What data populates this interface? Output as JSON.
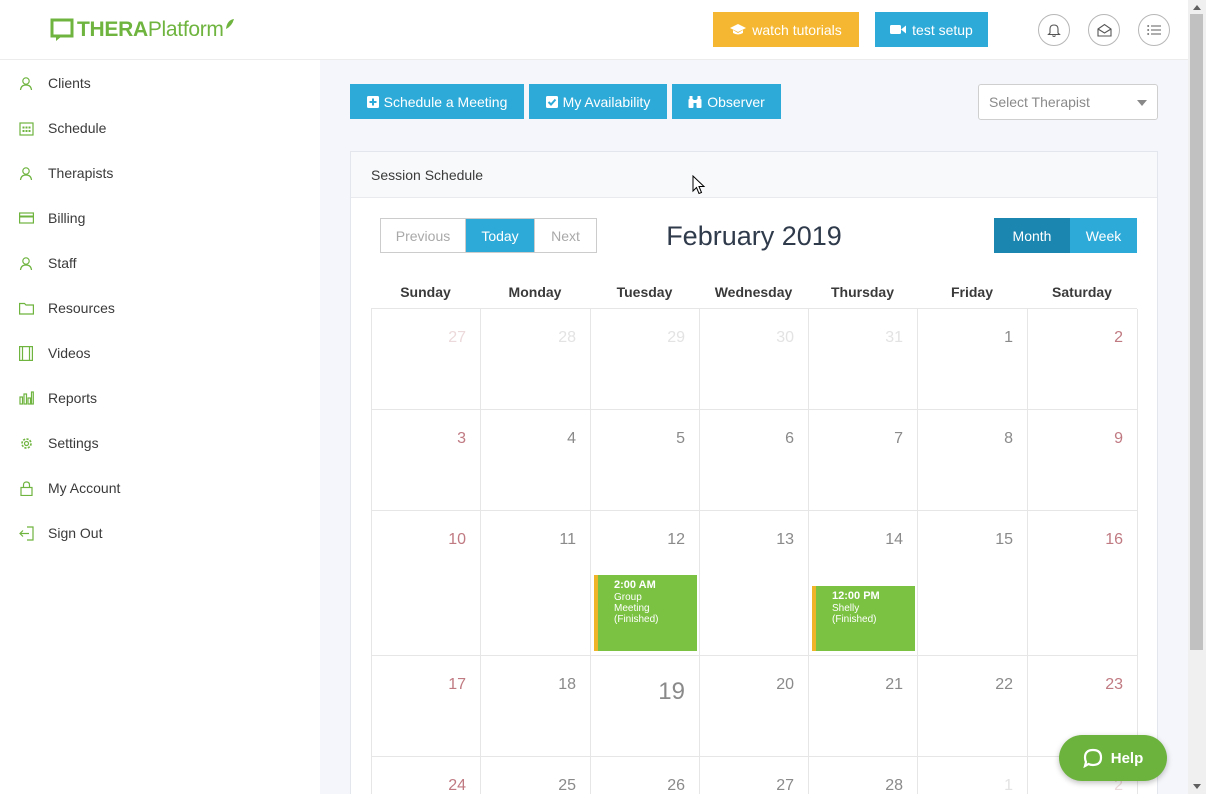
{
  "app": {
    "logo_bold": "THERA",
    "logo_light": "Platform",
    "brand_color": "#6eb43f"
  },
  "header": {
    "tutorials_label": "watch tutorials",
    "test_setup_label": "test setup",
    "icons": [
      "bell-icon",
      "mail-icon",
      "menu-list-icon"
    ]
  },
  "sidebar": {
    "items": [
      {
        "label": "Clients",
        "icon": "user-icon"
      },
      {
        "label": "Schedule",
        "icon": "calendar-icon"
      },
      {
        "label": "Therapists",
        "icon": "user-icon"
      },
      {
        "label": "Billing",
        "icon": "card-icon"
      },
      {
        "label": "Staff",
        "icon": "user-icon"
      },
      {
        "label": "Resources",
        "icon": "folder-icon"
      },
      {
        "label": "Videos",
        "icon": "film-icon"
      },
      {
        "label": "Reports",
        "icon": "bar-chart-icon"
      },
      {
        "label": "Settings",
        "icon": "gear-icon"
      },
      {
        "label": "My Account",
        "icon": "lock-icon"
      },
      {
        "label": "Sign Out",
        "icon": "sign-out-icon"
      }
    ]
  },
  "actions": {
    "schedule_meeting": "Schedule a Meeting",
    "my_availability": "My Availability",
    "observer": "Observer",
    "therapist_placeholder": "Select Therapist"
  },
  "calendar": {
    "panel_title": "Session Schedule",
    "title": "February 2019",
    "nav": {
      "previous": "Previous",
      "today": "Today",
      "next": "Next"
    },
    "views": {
      "month": "Month",
      "week": "Week",
      "active": "Month"
    },
    "weekdays": [
      "Sunday",
      "Monday",
      "Tuesday",
      "Wednesday",
      "Thursday",
      "Friday",
      "Saturday"
    ],
    "weeks": [
      [
        "27",
        "28",
        "29",
        "30",
        "31",
        "1",
        "2"
      ],
      [
        "3",
        "4",
        "5",
        "6",
        "7",
        "8",
        "9"
      ],
      [
        "10",
        "11",
        "12",
        "13",
        "14",
        "15",
        "16"
      ],
      [
        "17",
        "18",
        "19",
        "20",
        "21",
        "22",
        "23"
      ],
      [
        "24",
        "25",
        "26",
        "27",
        "28",
        "1",
        "2"
      ]
    ],
    "today_date": "19",
    "events": [
      {
        "time": "2:00 AM",
        "lines": [
          "Group",
          "Meeting",
          "(Finished)"
        ],
        "day": "12"
      },
      {
        "time": "12:00 PM",
        "lines": [
          "Shelly",
          "(Finished)"
        ],
        "day": "14"
      }
    ],
    "event_color": "#7bc242",
    "event_accent": "#f0b428"
  },
  "help": {
    "label": "Help"
  }
}
